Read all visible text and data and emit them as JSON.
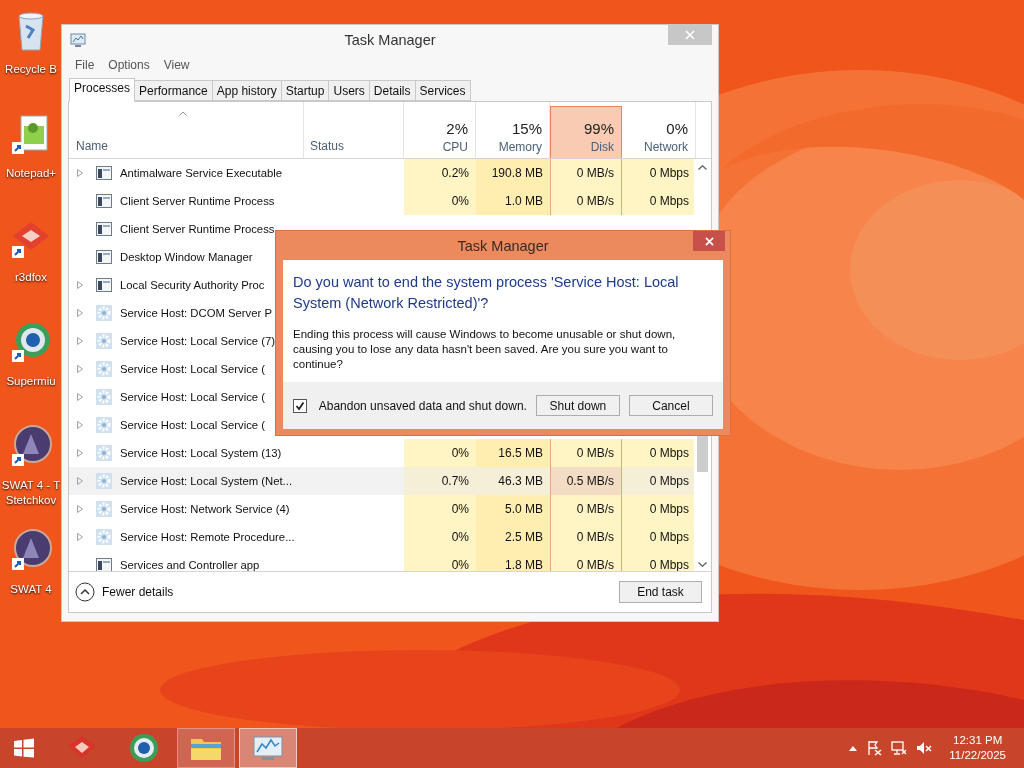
{
  "desktop_icons": [
    {
      "label": "Recycle B",
      "kind": "recycle",
      "shortcut": false
    },
    {
      "label": "Notepad+",
      "kind": "notepad",
      "shortcut": true
    },
    {
      "label": "r3dfox",
      "kind": "diamond",
      "shortcut": true
    },
    {
      "label": "Supermiu",
      "kind": "globe",
      "shortcut": true
    },
    {
      "label": "SWAT 4 - T Stetchkov",
      "kind": "emblem",
      "shortcut": true
    },
    {
      "label": "SWAT 4",
      "kind": "emblem",
      "shortcut": true
    }
  ],
  "window": {
    "title": "Task Manager",
    "menu": [
      "File",
      "Options",
      "View"
    ],
    "tabs": [
      {
        "label": "Processes",
        "selected": true
      },
      {
        "label": "Performance",
        "selected": false
      },
      {
        "label": "App history",
        "selected": false
      },
      {
        "label": "Startup",
        "selected": false
      },
      {
        "label": "Users",
        "selected": false
      },
      {
        "label": "Details",
        "selected": false
      },
      {
        "label": "Services",
        "selected": false
      }
    ],
    "name_header": {
      "label": "Name",
      "sorted": true
    },
    "status_header": "Status",
    "metric_headers": [
      {
        "percent": "2%",
        "label": "CPU",
        "selected": false
      },
      {
        "percent": "15%",
        "label": "Memory",
        "selected": false
      },
      {
        "percent": "99%",
        "label": "Disk",
        "selected": true
      },
      {
        "percent": "0%",
        "label": "Network",
        "selected": false
      }
    ],
    "rows": [
      {
        "name": "Antimalware Service Executable",
        "expandable": true,
        "kind": "app",
        "selected": false,
        "values": [
          "0.2%",
          "190.8 MB",
          "0 MB/s",
          "0 Mbps"
        ]
      },
      {
        "name": "Client Server Runtime Process",
        "expandable": false,
        "kind": "app",
        "selected": false,
        "values": [
          "0%",
          "1.0 MB",
          "0 MB/s",
          "0 Mbps"
        ]
      },
      {
        "name": "Client Server Runtime Process",
        "expandable": false,
        "kind": "app",
        "selected": false
      },
      {
        "name": "Desktop Window Manager",
        "expandable": false,
        "kind": "app",
        "selected": false
      },
      {
        "name": "Local Security Authority Proc",
        "expandable": true,
        "kind": "app",
        "selected": false
      },
      {
        "name": "Service Host: DCOM Server P",
        "expandable": true,
        "kind": "gear",
        "selected": false
      },
      {
        "name": "Service Host: Local Service (7)",
        "expandable": true,
        "kind": "gear",
        "selected": false
      },
      {
        "name": "Service Host: Local Service (",
        "expandable": true,
        "kind": "gear",
        "selected": false
      },
      {
        "name": "Service Host: Local Service (",
        "expandable": true,
        "kind": "gear",
        "selected": false
      },
      {
        "name": "Service Host: Local Service (",
        "expandable": true,
        "kind": "gear",
        "selected": false
      },
      {
        "name": "Service Host: Local System (13)",
        "expandable": true,
        "kind": "gear",
        "selected": false,
        "values": [
          "0%",
          "16.5 MB",
          "0 MB/s",
          "0 Mbps"
        ]
      },
      {
        "name": "Service Host: Local System (Net...",
        "expandable": true,
        "kind": "gear",
        "selected": true,
        "values": [
          "0.7%",
          "46.3 MB",
          "0.5 MB/s",
          "0 Mbps"
        ]
      },
      {
        "name": "Service Host: Network Service (4)",
        "expandable": true,
        "kind": "gear",
        "selected": false,
        "values": [
          "0%",
          "5.0 MB",
          "0 MB/s",
          "0 Mbps"
        ]
      },
      {
        "name": "Service Host: Remote Procedure...",
        "expandable": true,
        "kind": "gear",
        "selected": false,
        "values": [
          "0%",
          "2.5 MB",
          "0 MB/s",
          "0 Mbps"
        ]
      },
      {
        "name": "Services and Controller app",
        "expandable": false,
        "kind": "app",
        "selected": false,
        "values": [
          "0%",
          "1.8 MB",
          "0 MB/s",
          "0 Mbps"
        ]
      }
    ],
    "fewer_details": "Fewer details",
    "end_task": "End task"
  },
  "dialog": {
    "title": "Task Manager",
    "question": "Do you want to end the system process 'Service Host: Local System (Network Restricted)'?",
    "message": "Ending this process will cause Windows to become unusable or shut down, causing you to lose any data hasn't been saved. Are you sure you want to continue?",
    "checkbox": {
      "label": "Abandon unsaved data and shut down.",
      "checked": true
    },
    "buttons": [
      "Shut down",
      "Cancel"
    ]
  },
  "taskbar": {
    "apps": [
      {
        "kind": "diamond",
        "running": false,
        "selected": false
      },
      {
        "kind": "globe",
        "running": false,
        "selected": false
      },
      {
        "kind": "folder",
        "running": true,
        "selected": false
      },
      {
        "kind": "monitor",
        "running": true,
        "selected": true
      }
    ],
    "time": "12:31 PM",
    "date": "11/22/2025"
  }
}
